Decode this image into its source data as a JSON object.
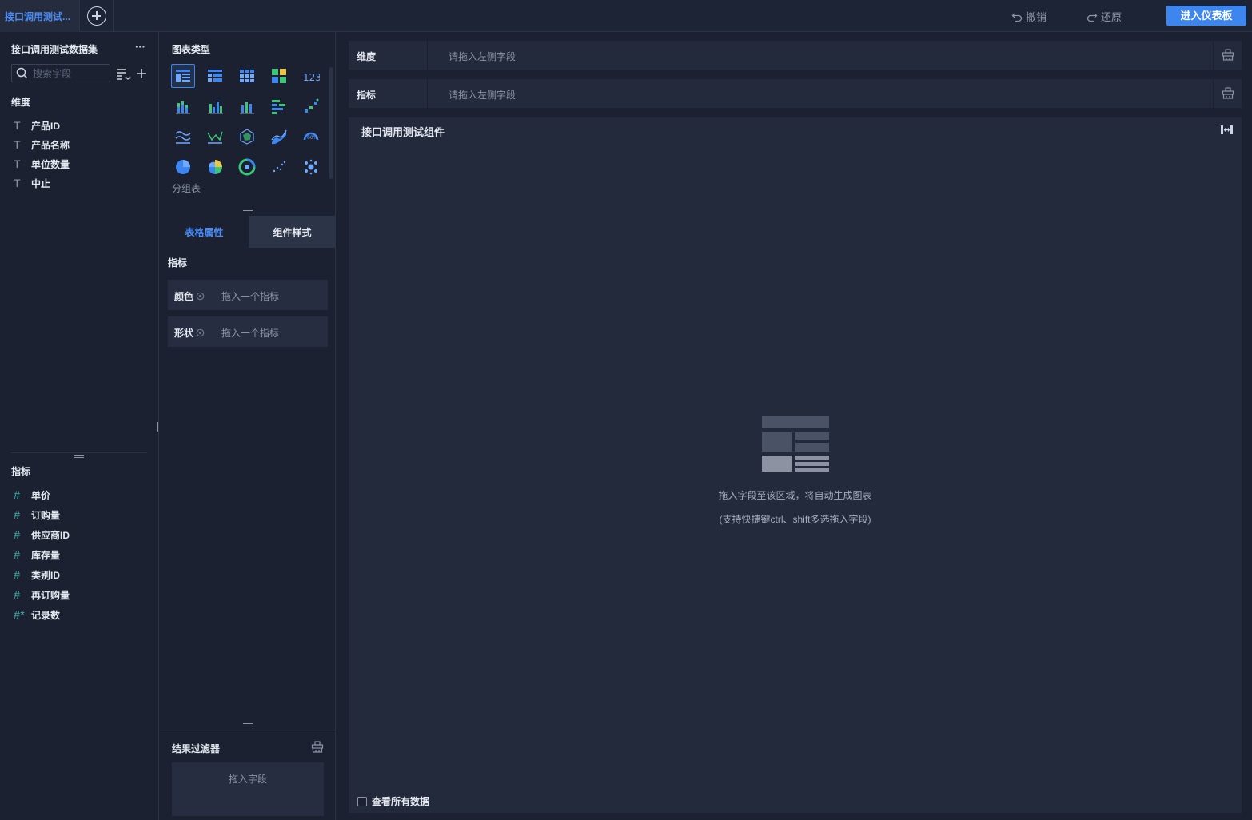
{
  "top": {
    "tab_label": "接口调用测试...",
    "undo": "撤销",
    "redo": "还原",
    "enter_dashboard": "进入仪表板"
  },
  "left": {
    "dataset_title": "接口调用测试数据集",
    "more": "···",
    "search_placeholder": "搜索字段",
    "dimension_heading": "维度",
    "dimensions": [
      "产品ID",
      "产品名称",
      "单位数量",
      "中止"
    ],
    "metric_heading": "指标",
    "metrics": [
      "单价",
      "订购量",
      "供应商ID",
      "库存量",
      "类别ID",
      "再订购量",
      "记录数"
    ]
  },
  "middle": {
    "chart_type_heading": "图表类型",
    "chart_types": [
      "table-icon",
      "cross-table-icon",
      "detail-table-icon",
      "heatmap-table-icon",
      "kpi-number-icon",
      "stacked-bar-icon",
      "grouped-bar-icon",
      "column-icon",
      "horizontal-bar-icon",
      "scatter-step-icon",
      "multi-line-icon",
      "line-icon",
      "radar-icon",
      "area-icon",
      "gauge-icon",
      "pie-icon",
      "rose-icon",
      "donut-icon",
      "dot-scatter-icon",
      "bubble-icon"
    ],
    "selected_chart_label": "分组表",
    "tab_table_props": "表格属性",
    "tab_comp_style": "组件样式",
    "metric_section": "指标",
    "color_label": "颜色",
    "shape_label": "形状",
    "drop_metric": "拖入一个指标",
    "result_filter": "结果过滤器",
    "drop_field": "拖入字段"
  },
  "right": {
    "dimension_shelf": "维度",
    "metric_shelf": "指标",
    "shelf_placeholder": "请拖入左侧字段",
    "component_title": "接口调用测试组件",
    "hint1": "拖入字段至该区域，将自动生成图表",
    "hint2": "(支持快捷键ctrl、shift多选拖入字段)",
    "view_all": "查看所有数据"
  },
  "colors": {
    "accent": "#3d86f0",
    "metric_icon": "#3fb6ae",
    "background": "#1b2130",
    "panel": "#232a3c"
  }
}
